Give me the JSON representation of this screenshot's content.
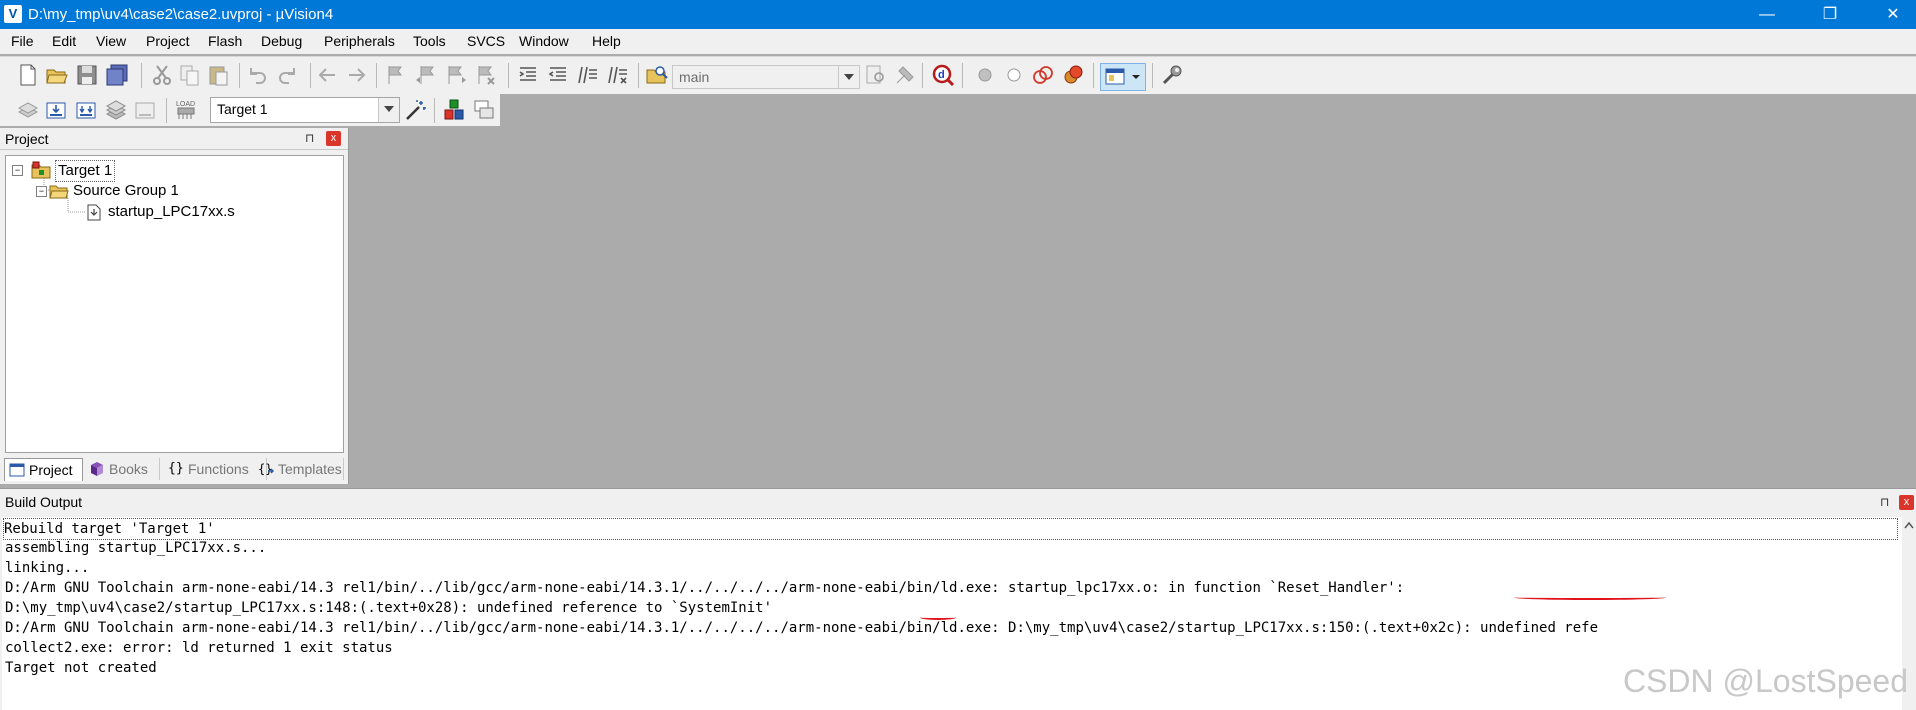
{
  "window": {
    "title": "D:\\my_tmp\\uv4\\case2\\case2.uvproj - µVision4",
    "icon_letter": "V",
    "minimize": "—",
    "maximize": "❐",
    "close": "✕"
  },
  "menu": [
    "File",
    "Edit",
    "View",
    "Project",
    "Flash",
    "Debug",
    "Peripherals",
    "Tools",
    "SVCS",
    "Window",
    "Help"
  ],
  "toolbar": {
    "find_combo_value": "main",
    "target_combo_value": "Target 1"
  },
  "project_panel": {
    "title": "Project",
    "pin": "⊓",
    "close": "x",
    "tree": {
      "target": "Target 1",
      "group": "Source Group 1",
      "file": "startup_LPC17xx.s"
    },
    "tabs": [
      "Project",
      "Books",
      "Functions",
      "Templates"
    ],
    "active_tab": "Project"
  },
  "build_output": {
    "title": "Build Output",
    "pin": "⊓",
    "close": "x",
    "lines": [
      "Rebuild target 'Target 1'",
      "assembling startup_LPC17xx.s...",
      "linking...",
      "D:/Arm GNU Toolchain arm-none-eabi/14.3 rel1/bin/../lib/gcc/arm-none-eabi/14.3.1/../../../../arm-none-eabi/bin/ld.exe: startup_lpc17xx.o: in function `Reset_Handler':",
      "D:\\my_tmp\\uv4\\case2/startup_LPC17xx.s:148:(.text+0x28): undefined reference to `SystemInit'",
      "D:/Arm GNU Toolchain arm-none-eabi/14.3 rel1/bin/../lib/gcc/arm-none-eabi/14.3.1/../../../../arm-none-eabi/bin/ld.exe: D:\\my_tmp\\uv4\\case2/startup_LPC17xx.s:150:(.text+0x2c): undefined refe",
      "collect2.exe: error: ld returned 1 exit status",
      "Target not created"
    ]
  },
  "watermark": "CSDN @LostSpeed",
  "colors": {
    "titlebar": "#0078d7",
    "editor_background": "#ababab",
    "annotation_underline": "#e0121b"
  }
}
